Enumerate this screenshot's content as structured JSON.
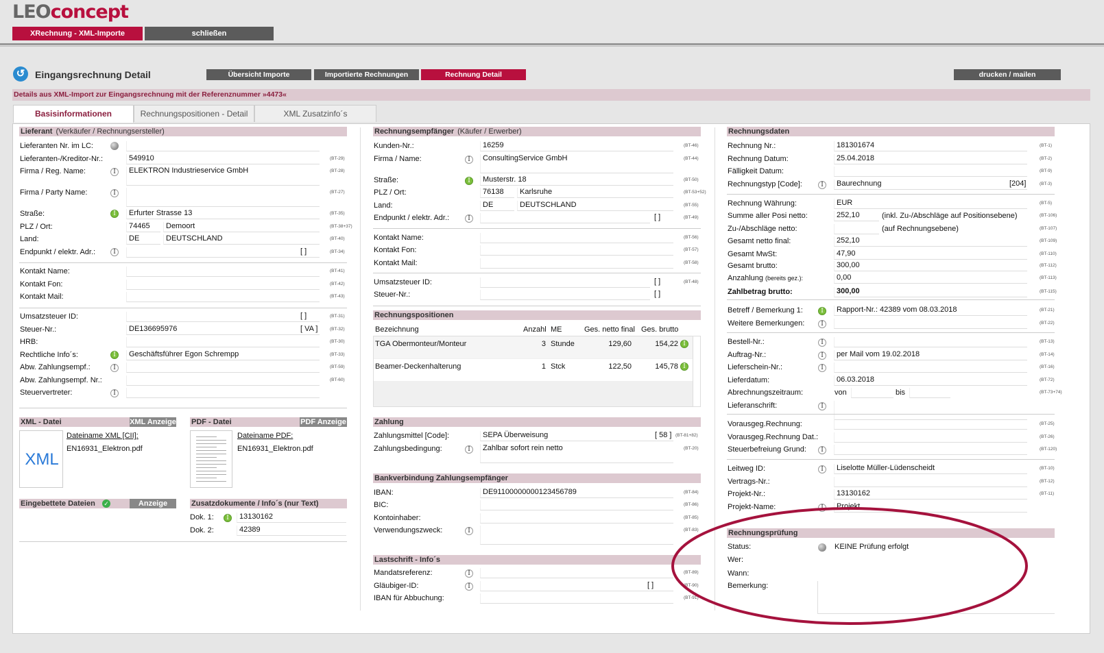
{
  "app": {
    "logo_a": "LEO",
    "logo_b": "concept",
    "btn1": "XRechnung - XML-Importe",
    "btn2": "schließen"
  },
  "nav": {
    "title": "Eingangsrechnung Detail",
    "b1": "Übersicht Importe",
    "b2": "Importierte Rechnungen",
    "b3": "Rechnung Detail",
    "print": "drucken / mailen"
  },
  "subline": "Details aus XML-Import zur Eingangsrechnung mit der Referenznummer »4473«",
  "tabs": [
    "Basisinformationen",
    "Rechnungspositionen - Detail",
    "XML Zusatzinfo´s"
  ],
  "lief": {
    "h": "Lieferant",
    "hn": "(Verkäufer / Rechnungsersteller)",
    "l": [
      "Lieferanten Nr. im LC:",
      "Lieferanten-/Kreditor-Nr.:",
      "Firma / Reg. Name:",
      "Firma / Party Name:",
      "Straße:",
      "PLZ / Ort:",
      "Land:",
      "Endpunkt / elektr. Adr.:",
      "Kontakt Name:",
      "Kontakt Fon:",
      "Kontakt Mail:",
      "Umsatzsteuer ID:",
      "Steuer-Nr.:",
      "HRB:",
      "Rechtliche Info´s:",
      "Abw. Zahlungsempf.:",
      "Abw. Zahlungsempf. Nr.:",
      "Steuervertreter:"
    ],
    "bt": [
      "",
      "(BT-29)",
      "(BT-28)",
      "(BT-27)",
      "(BT-35)",
      "(BT-38+37)",
      "(BT-40)",
      "(BT-34)",
      "(BT-41)",
      "(BT-42)",
      "(BT-43)",
      "(BT-31)",
      "(BT-32)",
      "(BT-30)",
      "(BT-33)",
      "(BT-59)",
      "(BT-60)",
      ""
    ],
    "kred": "549910",
    "firma": "ELEKTRON Industrieservice GmbH",
    "strasse": "Erfurter Strasse 13",
    "plz": "74465",
    "ort": "Demoort",
    "land_c": "DE",
    "land": "DEUTSCHLAND",
    "br": "[      ]",
    "steuer": "DE136695976",
    "va": "[ VA ]",
    "recht": "Geschäftsführer Egon Schrempp"
  },
  "xml": {
    "h": "XML - Datei",
    "btn": "XML Anzeige",
    "fl": "Dateiname XML [CII]:",
    "fn": "EN16931_Elektron.pdf",
    "icon": "XML"
  },
  "pdf": {
    "h": "PDF - Datei",
    "btn": "PDF Anzeige",
    "fl": "Dateiname PDF:",
    "fn": "EN16931_Elektron.pdf"
  },
  "emb": {
    "h": "Eingebettete Dateien",
    "btn": "Anzeige"
  },
  "zus": {
    "h": "Zusatzdokumente / Info´s (nur Text)",
    "l1": "Dok. 1:",
    "v1": "13130162",
    "l2": "Dok. 2:",
    "v2": "42389"
  },
  "emp": {
    "h": "Rechnungsempfänger",
    "hn": "(Käufer / Erwerber)",
    "l": [
      "Kunden-Nr.:",
      "Firma / Name:",
      "Straße:",
      "PLZ / Ort:",
      "Land:",
      "Endpunkt / elektr. Adr.:",
      "Kontakt Name:",
      "Kontakt Fon:",
      "Kontakt Mail:",
      "Umsatzsteuer ID:",
      "Steuer-Nr.:"
    ],
    "bt": [
      "(BT-46)",
      "(BT-44)",
      "(BT-50)",
      "(BT-53+52)",
      "(BT-55)",
      "(BT-49)",
      "(BT-56)",
      "(BT-57)",
      "(BT-58)",
      "(BT-48)",
      ""
    ],
    "kunde": "16259",
    "firma": "ConsultingService GmbH",
    "strasse": "Musterstr. 18",
    "plz": "76138",
    "ort": "Karlsruhe",
    "land_c": "DE",
    "land": "DEUTSCHLAND",
    "br": "[      ]"
  },
  "pos": {
    "h": "Rechnungspositionen",
    "cols": [
      "Bezeichnung",
      "Anzahl",
      "ME",
      "Ges. netto final",
      "Ges. brutto"
    ],
    "rows": [
      {
        "b": "TGA Obermonteur/Monteur",
        "a": "3",
        "me": "Stunde",
        "n": "129,60",
        "g": "154,22"
      },
      {
        "b": "Beamer-Deckenhalterung",
        "a": "1",
        "me": "Stck",
        "n": "122,50",
        "g": "145,78"
      }
    ]
  },
  "zahl": {
    "h": "Zahlung",
    "l1": "Zahlungsmittel [Code]:",
    "v1": "SEPA Überweisung",
    "c1": "[ 58 ]",
    "bt1": "(BT-81+82)",
    "l2": "Zahlungsbedingung:",
    "v2": "Zahlbar sofort rein netto",
    "bt2": "(BT-20)"
  },
  "bank": {
    "h": "Bankverbindung Zahlungsempfänger",
    "l": [
      "IBAN:",
      "BIC:",
      "Kontoinhaber:",
      "Verwendungszweck:"
    ],
    "bt": [
      "(BT-84)",
      "(BT-86)",
      "(BT-85)",
      "(BT-83)"
    ],
    "iban": "DE91100000000123456789"
  },
  "last": {
    "h": "Lastschrift - Info´s",
    "l": [
      "Mandatsreferenz:",
      "Gläubiger-ID:",
      "IBAN für Abbuchung:"
    ],
    "bt": [
      "(BT-89)",
      "(BT-90)",
      "(BT-91)"
    ],
    "br": "[      ]"
  },
  "rd": {
    "h": "Rechnungsdaten",
    "l": [
      "Rechnung Nr.:",
      "Rechnung Datum:",
      "Fälligkeit Datum:",
      "Rechnungstyp [Code]:",
      "Rechnung Währung:",
      "Summe aller Posi netto:",
      "Zu-/Abschläge netto:",
      "Gesamt netto final:",
      "Gesamt MwSt:",
      "Gesamt brutto:",
      "Anzahlung",
      "Zahlbetrag brutto:",
      "Betreff / Bemerkung 1:",
      "Weitere Bemerkungen:",
      "Bestell-Nr.:",
      "Auftrag-Nr.:",
      "Lieferschein-Nr.:",
      "Lieferdatum:",
      "Abrechnungszeitraum:",
      "Lieferanschrift:",
      "Vorausgeg.Rechnung:",
      "Vorausgeg.Rechnung Dat.:",
      "Steuerbefreiung Grund:",
      "Leitweg ID:",
      "Vertrags-Nr.:",
      "Projekt-Nr.:",
      "Projekt-Name:"
    ],
    "bt": [
      "(BT-1)",
      "(BT-2)",
      "(BT-9)",
      "(BT-3)",
      "(BT-5)",
      "(BT-106)",
      "(BT-107)",
      "(BT-109)",
      "(BT-110)",
      "(BT-112)",
      "(BT-113)",
      "(BT-115)",
      "(BT-21)",
      "(BT-22)",
      "(BT-13)",
      "(BT-14)",
      "(BT-16)",
      "(BT-72)",
      "(BT-73+74)",
      "",
      "(BT-25)",
      "(BT-26)",
      "(BT-120)",
      "(BT-10)",
      "(BT-12)",
      "(BT-11)",
      ""
    ],
    "anz_small": "(bereits gez.):",
    "nr": "181301674",
    "datum": "25.04.2018",
    "typ": "Baurechnung",
    "typc": "[204]",
    "waehr": "EUR",
    "summe": "252,10",
    "summe_note": "(inkl. Zu-/Abschläge auf Positionsebene)",
    "zu_note": "(auf Rechnungsebene)",
    "netto": "252,10",
    "mwst": "47,90",
    "brutto": "300,00",
    "anz": "0,00",
    "zahlb": "300,00",
    "betreff": "Rapport-Nr.: 42389 vom 08.03.2018",
    "auftrag": "per Mail vom 19.02.2018",
    "liefd": "06.03.2018",
    "von": "von",
    "bis": "bis",
    "leitweg": "Liselotte Müller-Lüdenscheidt",
    "projnr": "13130162",
    "projname": "Projekt"
  },
  "pr": {
    "h": "Rechnungsprüfung",
    "l": [
      "Status:",
      "Wer:",
      "Wann:",
      "Bemerkung:"
    ],
    "status": "KEINE Prüfung erfolgt"
  }
}
